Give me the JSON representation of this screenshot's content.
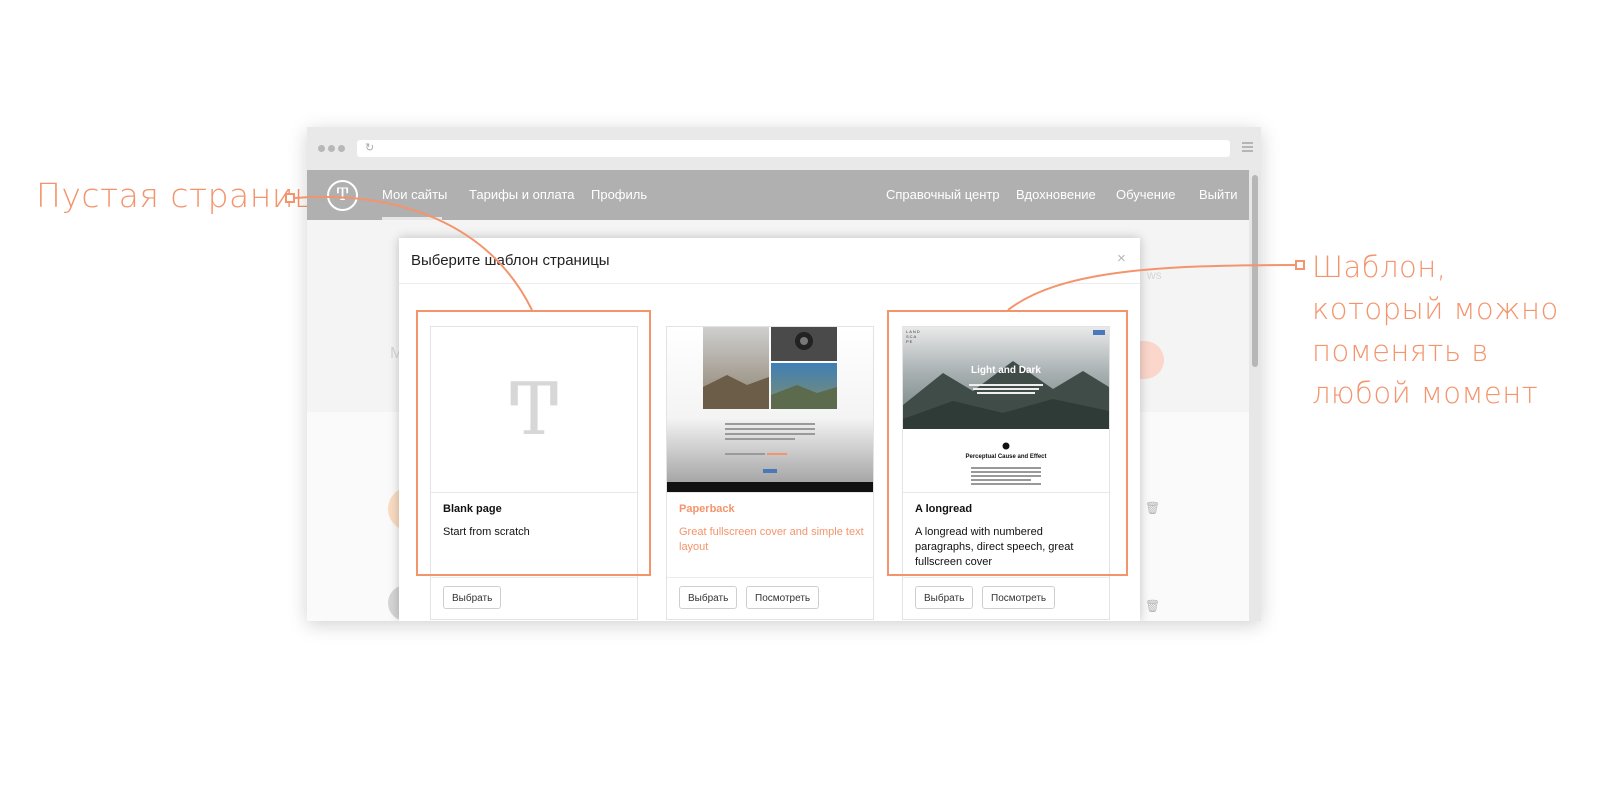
{
  "annotations": {
    "blank_label": "Пустая страница",
    "template_label_lines": [
      "Шаблон,",
      "который можно",
      "поменять в",
      "любой момент"
    ]
  },
  "colors": {
    "accent": "#f4946c",
    "nav_bg": "#b0b0b0"
  },
  "nav": {
    "logo": "Ͳ",
    "left": [
      "Мои сайты",
      "Тарифы и оплата",
      "Профиль"
    ],
    "right": [
      "Справочный центр",
      "Вдохновение",
      "Обучение",
      "Выйти"
    ]
  },
  "background": {
    "side_letter": "М",
    "faint_right": "ws"
  },
  "modal": {
    "title": "Выберите шаблон страницы",
    "close": "×",
    "cards": [
      {
        "name": "Blank page",
        "desc": "Start from scratch",
        "thumb_glyph": "Ͳ",
        "buttons": [
          "Выбрать"
        ]
      },
      {
        "name": "Paperback",
        "desc": "Great fullscreen cover and simple text layout",
        "buttons": [
          "Выбрать",
          "Посмотреть"
        ]
      },
      {
        "name": "A longread",
        "desc": "A longread with numbered paragraphs, direct speech, great fullscreen cover",
        "thumb_title": "Light and Dark",
        "thumb_section": "Perceptual Cause and Effect",
        "thumb_logo": "LAND SCA PE",
        "buttons": [
          "Выбрать",
          "Посмотреть"
        ]
      }
    ]
  }
}
